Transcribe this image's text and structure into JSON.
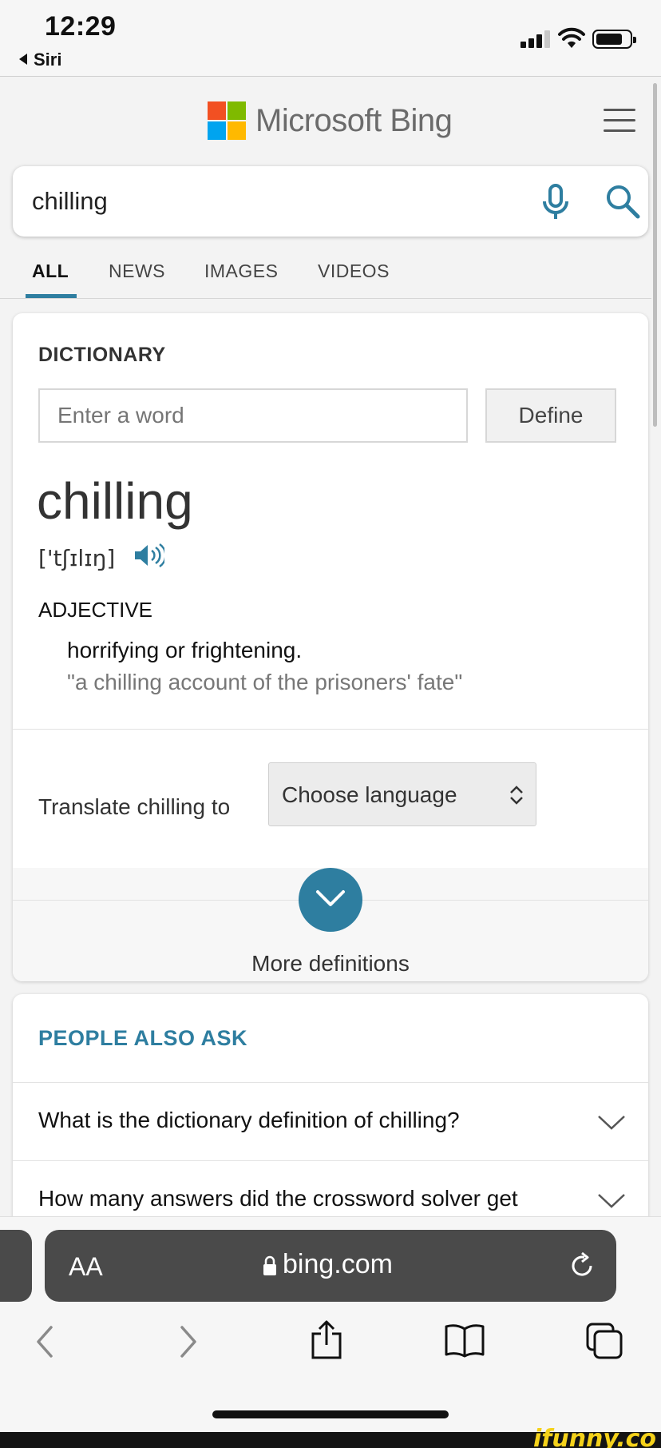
{
  "status_bar": {
    "time": "12:29",
    "back_app": "Siri"
  },
  "header": {
    "brand": "Microsoft Bing",
    "logo_colors": [
      "#f25022",
      "#7fba00",
      "#00a4ef",
      "#ffb900"
    ],
    "menu_icon": "hamburger-menu-icon"
  },
  "search": {
    "query": "chilling",
    "mic_icon": "microphone-icon",
    "search_icon": "search-icon"
  },
  "tabs": [
    {
      "label": "ALL",
      "active": true
    },
    {
      "label": "NEWS"
    },
    {
      "label": "IMAGES"
    },
    {
      "label": "VIDEOS"
    }
  ],
  "dictionary": {
    "title": "DICTIONARY",
    "input_placeholder": "Enter a word",
    "define_label": "Define",
    "word": "chilling",
    "pronunciation": "['tʃɪlɪŋ]",
    "part_of_speech": "ADJECTIVE",
    "definition": "horrifying or frightening.",
    "example": "\"a chilling account of the prisoners' fate\"",
    "translate_label": "Translate chilling to",
    "language_select": "Choose language",
    "more_label": "More definitions"
  },
  "people_also_ask": {
    "title": "PEOPLE ALSO ASK",
    "questions": [
      "What is the dictionary definition of chilling?",
      "How many answers did the crossword solver get"
    ]
  },
  "browser": {
    "text_size_label": "AA",
    "url": "bing.com"
  },
  "watermark": "ifunny.co",
  "colors": {
    "accent": "#2e7ea0",
    "page_bg": "#f3f3f3",
    "url_bar": "#4a4a4a"
  }
}
